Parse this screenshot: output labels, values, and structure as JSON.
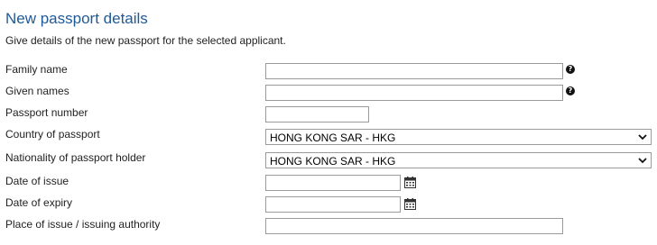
{
  "section": {
    "title": "New passport details",
    "subtitle": "Give details of the new passport for the selected applicant."
  },
  "fields": {
    "family_name": {
      "label": "Family name",
      "value": ""
    },
    "given_names": {
      "label": "Given names",
      "value": ""
    },
    "passport_number": {
      "label": "Passport number",
      "value": ""
    },
    "country_of_passport": {
      "label": "Country of passport",
      "selected": "HONG KONG SAR - HKG"
    },
    "nationality": {
      "label": "Nationality of passport holder",
      "selected": "HONG KONG SAR - HKG"
    },
    "date_of_issue": {
      "label": "Date of issue",
      "value": ""
    },
    "date_of_expiry": {
      "label": "Date of expiry",
      "value": ""
    },
    "place_of_issue": {
      "label": "Place of issue / issuing authority",
      "value": ""
    }
  },
  "icons": {
    "help": "help-icon",
    "calendar": "calendar-icon",
    "dropdown": "chevron-down-icon"
  },
  "colors": {
    "title": "#1f5a96",
    "border": "#9a9a9a"
  }
}
